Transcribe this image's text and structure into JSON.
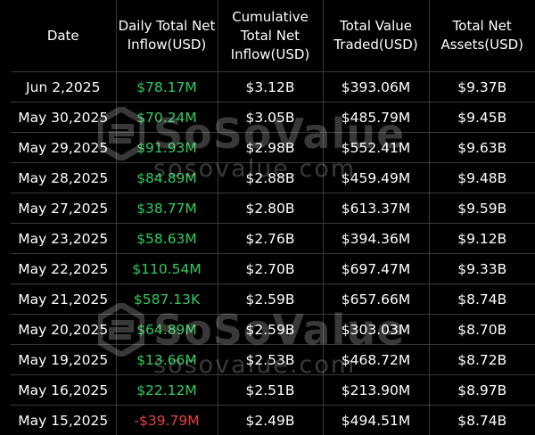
{
  "table": {
    "headers": [
      "Date",
      "Daily Total Net Inflow(USD)",
      "Cumulative Total Net Inflow(USD)",
      "Total Value Traded(USD)",
      "Total Net Assets(USD)"
    ],
    "rows": [
      {
        "date": "Jun 2,2025",
        "inflow": "$78.17M",
        "inflow_sign": "pos",
        "cumulative": "$3.12B",
        "traded": "$393.06M",
        "assets": "$9.37B"
      },
      {
        "date": "May 30,2025",
        "inflow": "$70.24M",
        "inflow_sign": "pos",
        "cumulative": "$3.05B",
        "traded": "$485.79M",
        "assets": "$9.45B"
      },
      {
        "date": "May 29,2025",
        "inflow": "$91.93M",
        "inflow_sign": "pos",
        "cumulative": "$2.98B",
        "traded": "$552.41M",
        "assets": "$9.63B"
      },
      {
        "date": "May 28,2025",
        "inflow": "$84.89M",
        "inflow_sign": "pos",
        "cumulative": "$2.88B",
        "traded": "$459.49M",
        "assets": "$9.48B"
      },
      {
        "date": "May 27,2025",
        "inflow": "$38.77M",
        "inflow_sign": "pos",
        "cumulative": "$2.80B",
        "traded": "$613.37M",
        "assets": "$9.59B"
      },
      {
        "date": "May 23,2025",
        "inflow": "$58.63M",
        "inflow_sign": "pos",
        "cumulative": "$2.76B",
        "traded": "$394.36M",
        "assets": "$9.12B"
      },
      {
        "date": "May 22,2025",
        "inflow": "$110.54M",
        "inflow_sign": "pos",
        "cumulative": "$2.70B",
        "traded": "$697.47M",
        "assets": "$9.33B"
      },
      {
        "date": "May 21,2025",
        "inflow": "$587.13K",
        "inflow_sign": "pos",
        "cumulative": "$2.59B",
        "traded": "$657.66M",
        "assets": "$8.74B"
      },
      {
        "date": "May 20,2025",
        "inflow": "$64.89M",
        "inflow_sign": "pos",
        "cumulative": "$2.59B",
        "traded": "$303.03M",
        "assets": "$8.70B"
      },
      {
        "date": "May 19,2025",
        "inflow": "$13.66M",
        "inflow_sign": "pos",
        "cumulative": "$2.53B",
        "traded": "$468.72M",
        "assets": "$8.72B"
      },
      {
        "date": "May 16,2025",
        "inflow": "$22.12M",
        "inflow_sign": "pos",
        "cumulative": "$2.51B",
        "traded": "$213.90M",
        "assets": "$8.97B"
      },
      {
        "date": "May 15,2025",
        "inflow": "-$39.79M",
        "inflow_sign": "neg",
        "cumulative": "$2.49B",
        "traded": "$494.51M",
        "assets": "$8.74B"
      }
    ]
  },
  "watermark": {
    "brand": "SoSoValue",
    "url": "sosovalue.com",
    "icon": "sosovalue-logo-icon"
  },
  "colors": {
    "background": "#000000",
    "positive": "#2ecc5a",
    "negative": "#e84040",
    "text": "#ffffff",
    "grid": "#3a3a3a"
  }
}
